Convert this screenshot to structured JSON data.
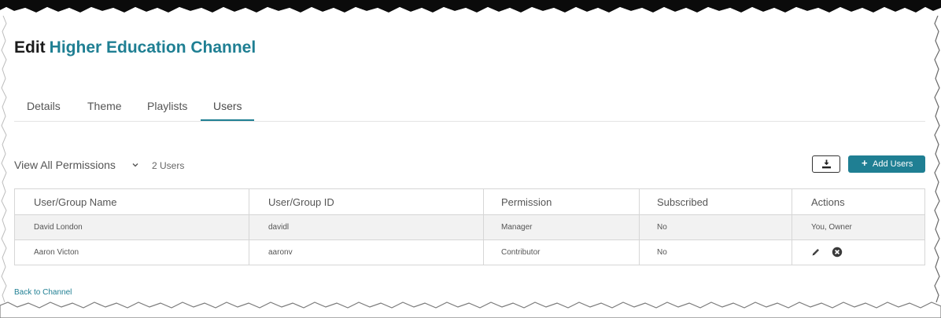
{
  "page": {
    "title_prefix": "Edit",
    "channel_name": "Higher Education Channel"
  },
  "tabs": [
    {
      "label": "Details",
      "active": false
    },
    {
      "label": "Theme",
      "active": false
    },
    {
      "label": "Playlists",
      "active": false
    },
    {
      "label": "Users",
      "active": true
    }
  ],
  "toolbar": {
    "permission_filter": "View All Permissions",
    "user_count": "2 Users",
    "download_icon": "download-icon",
    "add_users_label": "Add Users"
  },
  "table": {
    "headers": [
      "User/Group Name",
      "User/Group ID",
      "Permission",
      "Subscribed",
      "Actions"
    ],
    "rows": [
      {
        "name": "David London",
        "id": "davidl",
        "permission": "Manager",
        "subscribed": "No",
        "actions": "You, Owner"
      },
      {
        "name": "Aaron Victon",
        "id": "aaronv",
        "permission": "Contributor",
        "subscribed": "No",
        "actions": ""
      }
    ]
  },
  "footer": {
    "back_link": "Back to Channel"
  },
  "colors": {
    "accent": "#1f7f93",
    "row_alt": "#f2f2f2",
    "border": "#d6d6d6"
  }
}
